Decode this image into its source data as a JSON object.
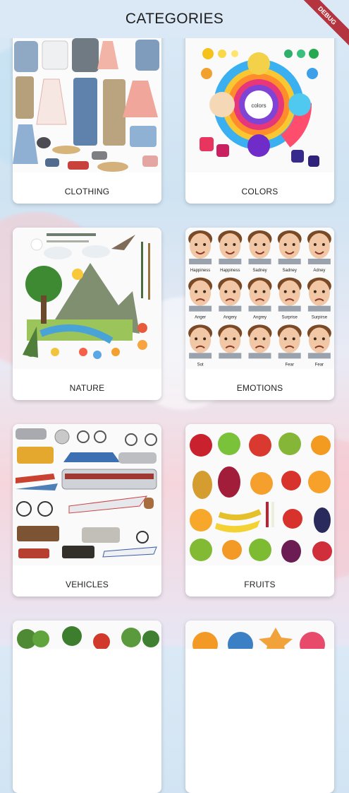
{
  "appbar": {
    "title": "CATEGORIES"
  },
  "debug_banner": "DEBUG",
  "categories": [
    {
      "label": "CLOTHING",
      "icon": "clothing-image"
    },
    {
      "label": "COLORS",
      "icon": "colors-image",
      "center_text": "colors"
    },
    {
      "label": "NATURE",
      "icon": "nature-image"
    },
    {
      "label": "EMOTIONS",
      "icon": "emotions-image",
      "captions": [
        "Happiness",
        "Happiness",
        "Sadney",
        "Sadney",
        "Adney",
        "Anger",
        "Angery",
        "Angrey",
        "Surprise",
        "Surpirse",
        "Sot",
        "",
        "",
        "Fear",
        "Fear"
      ]
    },
    {
      "label": "VEHICLES",
      "icon": "vehicles-image"
    },
    {
      "label": "FRUITS",
      "icon": "fruits-image"
    },
    {
      "label": "",
      "icon": "vegetables-image"
    },
    {
      "label": "",
      "icon": "shapes-image"
    }
  ]
}
